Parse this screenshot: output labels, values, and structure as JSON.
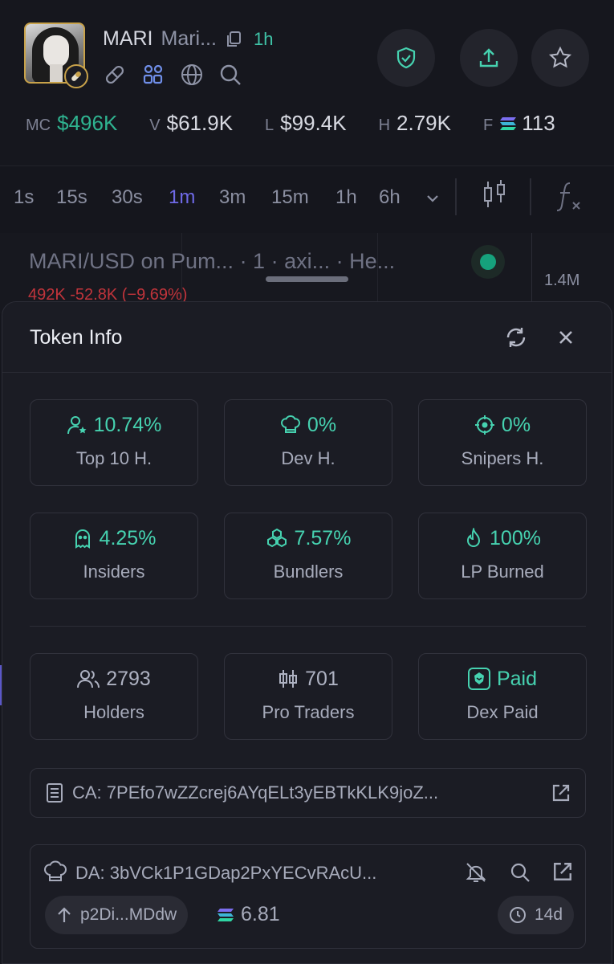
{
  "header": {
    "ticker": "MARI",
    "token_name": "Mari...",
    "age": "1h"
  },
  "stats": [
    {
      "label": "MC",
      "value": "$496K",
      "color": "#2fb390"
    },
    {
      "label": "V",
      "value": "$61.9K"
    },
    {
      "label": "L",
      "value": "$99.4K"
    },
    {
      "label": "H",
      "value": "2.79K"
    },
    {
      "label": "F",
      "value": "113"
    }
  ],
  "timeframes": [
    "1s",
    "15s",
    "30s",
    "1m",
    "3m",
    "15m",
    "1h",
    "6h"
  ],
  "active_timeframe": "1m",
  "chart": {
    "title": "MARI/USD on Pum... · 1 · axi... · He...",
    "ohlc": "492K -52.8K (−9.69%)",
    "volume_label": "1.4M"
  },
  "token_info": {
    "title": "Token Info",
    "metrics": [
      {
        "value": "10.74%",
        "caption": "Top 10 H.",
        "icon": "user-star-icon"
      },
      {
        "value": "0%",
        "caption": "Dev H.",
        "icon": "chef-hat-icon"
      },
      {
        "value": "0%",
        "caption": "Snipers H.",
        "icon": "crosshair-icon"
      },
      {
        "value": "4.25%",
        "caption": "Insiders",
        "icon": "ghost-icon"
      },
      {
        "value": "7.57%",
        "caption": "Bundlers",
        "icon": "boxes-icon"
      },
      {
        "value": "100%",
        "caption": "LP Burned",
        "icon": "flame-icon"
      }
    ],
    "holders": {
      "value": "2793",
      "caption": "Holders"
    },
    "pro_traders": {
      "value": "701",
      "caption": "Pro Traders"
    },
    "dex_paid": {
      "value": "Paid",
      "caption": "Dex Paid"
    },
    "ca": "CA: 7PEfo7wZZcrej6AYqELt3yEBTkKLK9joZ...",
    "da": "DA: 3bVCk1P1GDap2PxYECvRAcU...",
    "funding_address": "p2Di...MDdw",
    "sol_balance": "6.81",
    "dev_age": "14d"
  },
  "colors": {
    "accent_green": "#46d2b0",
    "accent_purple": "#6f6ae8",
    "negative": "#c0343b"
  }
}
